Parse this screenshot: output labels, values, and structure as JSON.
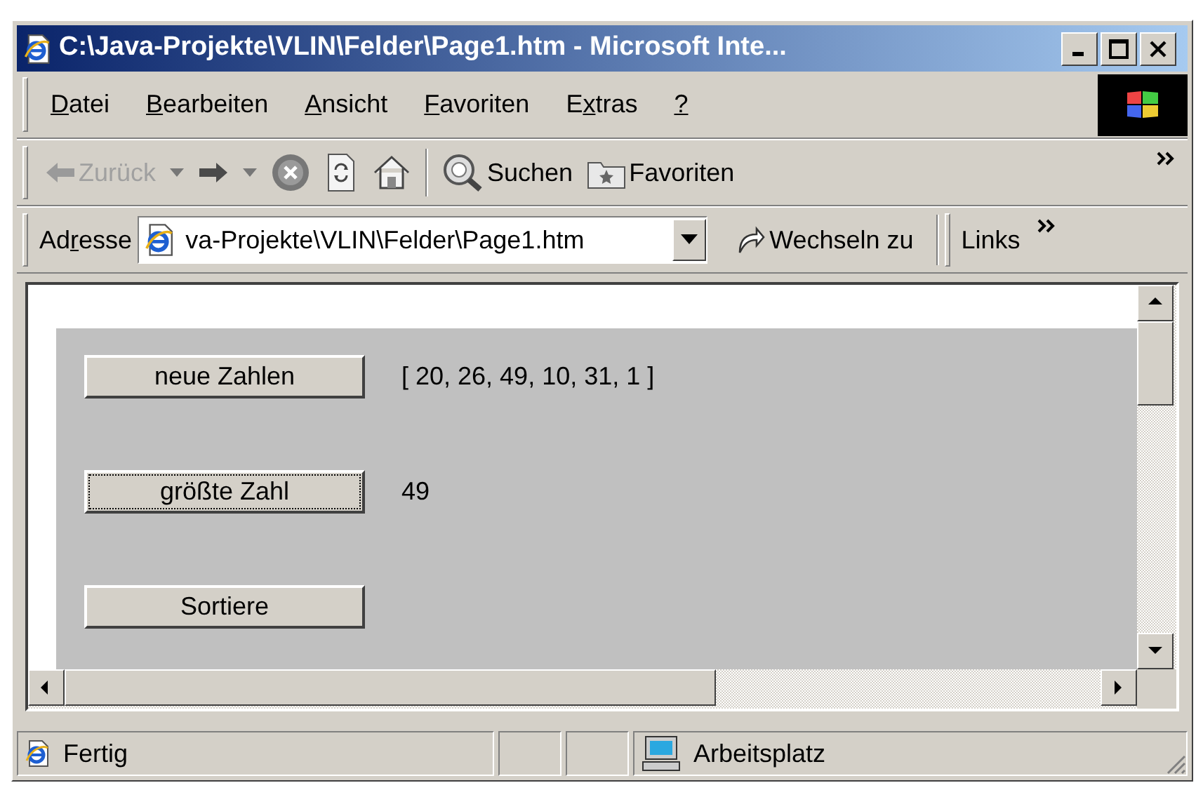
{
  "window": {
    "title": "C:\\Java-Projekte\\VLIN\\Felder\\Page1.htm - Microsoft Inte..."
  },
  "menu": [
    {
      "key": "D",
      "post": "atei"
    },
    {
      "key": "B",
      "post": "earbeiten"
    },
    {
      "key": "A",
      "post": "nsicht"
    },
    {
      "key": "F",
      "post": "avoriten"
    },
    {
      "pre": "E",
      "key": "x",
      "post": "tras"
    },
    {
      "key": "?"
    }
  ],
  "toolbar": [
    {
      "kind": "back",
      "label": "Zurück",
      "disabled": true
    },
    {
      "kind": "forward",
      "disabled": false
    },
    {
      "kind": "stop"
    },
    {
      "kind": "refresh"
    },
    {
      "kind": "home"
    },
    {
      "kind": "search",
      "label": "Suchen"
    },
    {
      "kind": "favorites",
      "label": "Favoriten"
    }
  ],
  "address": {
    "label": {
      "pre": "Ad",
      "key": "r",
      "post": "esse"
    },
    "value": "va-Projekte\\VLIN\\Felder\\Page1.htm",
    "go": "Wechseln zu",
    "links": "Links"
  },
  "page": {
    "rows": [
      {
        "button": "neue Zahlen",
        "focused": false,
        "output": "[ 20, 26, 49, 10, 31, 1 ]"
      },
      {
        "button": "größte Zahl",
        "focused": true,
        "output": "49"
      },
      {
        "button": "Sortiere",
        "focused": false
      }
    ]
  },
  "status_bar": {
    "text": "Fertig",
    "zone": "Arbeitsplatz"
  }
}
